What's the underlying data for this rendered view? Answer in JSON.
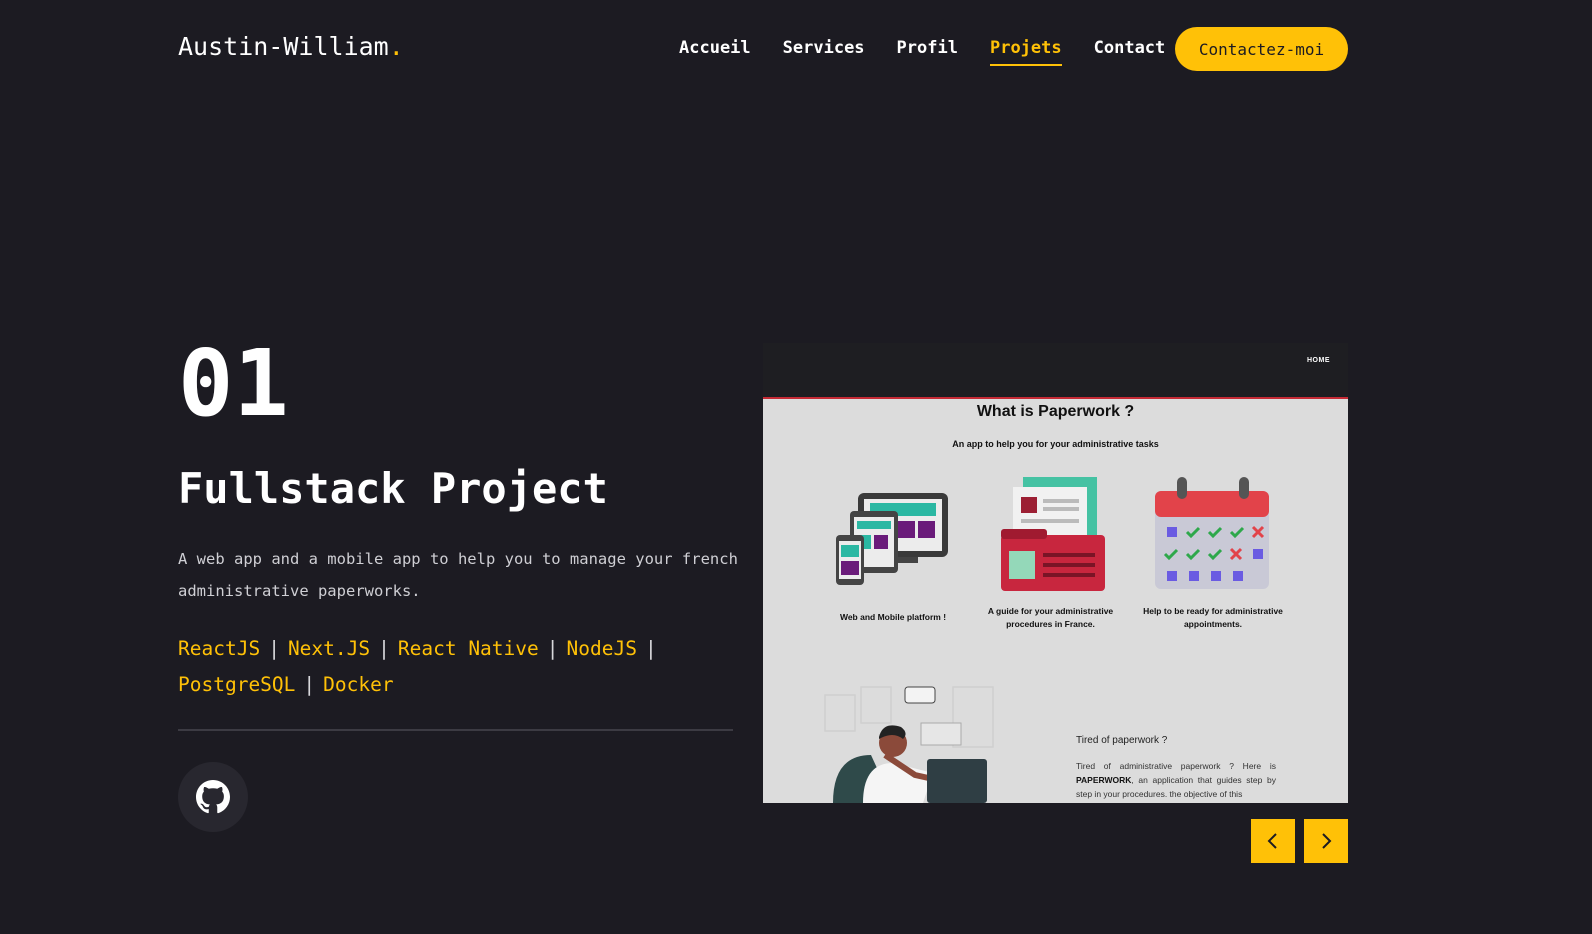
{
  "header": {
    "logo_text": "Austin-William",
    "logo_dot": ".",
    "nav": [
      {
        "label": "Accueil"
      },
      {
        "label": "Services"
      },
      {
        "label": "Profil"
      },
      {
        "label": "Projets",
        "active": true
      },
      {
        "label": "Contact"
      }
    ],
    "cta_label": "Contactez-moi"
  },
  "project": {
    "number": "01",
    "title": "Fullstack Project",
    "description": "A web app and a mobile app to help you to manage your french administrative paperworks.",
    "technologies": [
      "ReactJS",
      "Next.JS",
      "React Native",
      "NodeJS",
      "PostgreSQL",
      "Docker"
    ],
    "github_icon": "github-icon"
  },
  "screenshot": {
    "nav_item": "HOME",
    "heading": "What is Paperwork ?",
    "subheading": "An app to help you for your administrative tasks",
    "features": [
      {
        "caption": "Web and Mobile platform !"
      },
      {
        "caption": "A guide for your administrative procedures in France."
      },
      {
        "caption": "Help to be ready for administrative appointments."
      }
    ],
    "tired_title": "Tired of paperwork ?",
    "para_start": "Tired of administrative paperwork ? Here is",
    "para_bold": "PAPERWORK",
    "para_rest": ", an application that guides step by step in your procedures. the objective of this"
  },
  "slider": {
    "prev_icon": "chevron-left-icon",
    "next_icon": "chevron-right-icon"
  },
  "colors": {
    "background": "#1c1b22",
    "accent": "#ffc107",
    "text": "#ffffff"
  }
}
